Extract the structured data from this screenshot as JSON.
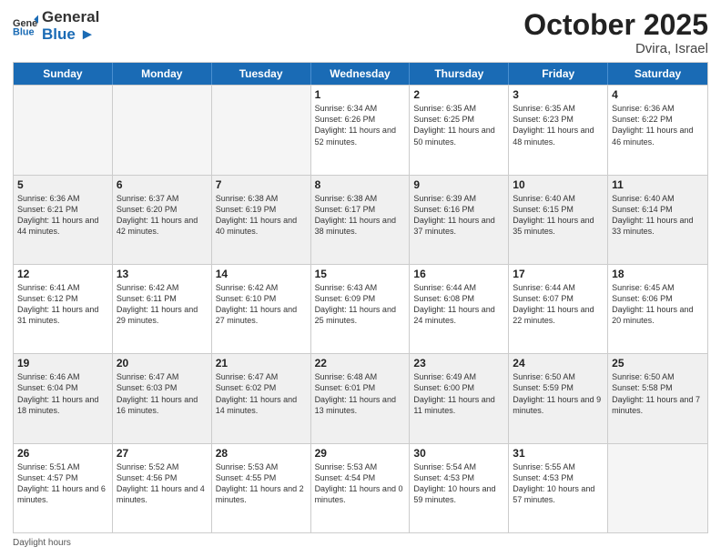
{
  "header": {
    "logo_general": "General",
    "logo_blue": "Blue",
    "month_title": "October 2025",
    "location": "Dvira, Israel"
  },
  "days_of_week": [
    "Sunday",
    "Monday",
    "Tuesday",
    "Wednesday",
    "Thursday",
    "Friday",
    "Saturday"
  ],
  "weeks": [
    [
      {
        "day": "",
        "empty": true
      },
      {
        "day": "",
        "empty": true
      },
      {
        "day": "",
        "empty": true
      },
      {
        "day": "1",
        "sunrise": "Sunrise: 6:34 AM",
        "sunset": "Sunset: 6:26 PM",
        "daylight": "Daylight: 11 hours and 52 minutes."
      },
      {
        "day": "2",
        "sunrise": "Sunrise: 6:35 AM",
        "sunset": "Sunset: 6:25 PM",
        "daylight": "Daylight: 11 hours and 50 minutes."
      },
      {
        "day": "3",
        "sunrise": "Sunrise: 6:35 AM",
        "sunset": "Sunset: 6:23 PM",
        "daylight": "Daylight: 11 hours and 48 minutes."
      },
      {
        "day": "4",
        "sunrise": "Sunrise: 6:36 AM",
        "sunset": "Sunset: 6:22 PM",
        "daylight": "Daylight: 11 hours and 46 minutes."
      }
    ],
    [
      {
        "day": "5",
        "sunrise": "Sunrise: 6:36 AM",
        "sunset": "Sunset: 6:21 PM",
        "daylight": "Daylight: 11 hours and 44 minutes."
      },
      {
        "day": "6",
        "sunrise": "Sunrise: 6:37 AM",
        "sunset": "Sunset: 6:20 PM",
        "daylight": "Daylight: 11 hours and 42 minutes."
      },
      {
        "day": "7",
        "sunrise": "Sunrise: 6:38 AM",
        "sunset": "Sunset: 6:19 PM",
        "daylight": "Daylight: 11 hours and 40 minutes."
      },
      {
        "day": "8",
        "sunrise": "Sunrise: 6:38 AM",
        "sunset": "Sunset: 6:17 PM",
        "daylight": "Daylight: 11 hours and 38 minutes."
      },
      {
        "day": "9",
        "sunrise": "Sunrise: 6:39 AM",
        "sunset": "Sunset: 6:16 PM",
        "daylight": "Daylight: 11 hours and 37 minutes."
      },
      {
        "day": "10",
        "sunrise": "Sunrise: 6:40 AM",
        "sunset": "Sunset: 6:15 PM",
        "daylight": "Daylight: 11 hours and 35 minutes."
      },
      {
        "day": "11",
        "sunrise": "Sunrise: 6:40 AM",
        "sunset": "Sunset: 6:14 PM",
        "daylight": "Daylight: 11 hours and 33 minutes."
      }
    ],
    [
      {
        "day": "12",
        "sunrise": "Sunrise: 6:41 AM",
        "sunset": "Sunset: 6:12 PM",
        "daylight": "Daylight: 11 hours and 31 minutes."
      },
      {
        "day": "13",
        "sunrise": "Sunrise: 6:42 AM",
        "sunset": "Sunset: 6:11 PM",
        "daylight": "Daylight: 11 hours and 29 minutes."
      },
      {
        "day": "14",
        "sunrise": "Sunrise: 6:42 AM",
        "sunset": "Sunset: 6:10 PM",
        "daylight": "Daylight: 11 hours and 27 minutes."
      },
      {
        "day": "15",
        "sunrise": "Sunrise: 6:43 AM",
        "sunset": "Sunset: 6:09 PM",
        "daylight": "Daylight: 11 hours and 25 minutes."
      },
      {
        "day": "16",
        "sunrise": "Sunrise: 6:44 AM",
        "sunset": "Sunset: 6:08 PM",
        "daylight": "Daylight: 11 hours and 24 minutes."
      },
      {
        "day": "17",
        "sunrise": "Sunrise: 6:44 AM",
        "sunset": "Sunset: 6:07 PM",
        "daylight": "Daylight: 11 hours and 22 minutes."
      },
      {
        "day": "18",
        "sunrise": "Sunrise: 6:45 AM",
        "sunset": "Sunset: 6:06 PM",
        "daylight": "Daylight: 11 hours and 20 minutes."
      }
    ],
    [
      {
        "day": "19",
        "sunrise": "Sunrise: 6:46 AM",
        "sunset": "Sunset: 6:04 PM",
        "daylight": "Daylight: 11 hours and 18 minutes."
      },
      {
        "day": "20",
        "sunrise": "Sunrise: 6:47 AM",
        "sunset": "Sunset: 6:03 PM",
        "daylight": "Daylight: 11 hours and 16 minutes."
      },
      {
        "day": "21",
        "sunrise": "Sunrise: 6:47 AM",
        "sunset": "Sunset: 6:02 PM",
        "daylight": "Daylight: 11 hours and 14 minutes."
      },
      {
        "day": "22",
        "sunrise": "Sunrise: 6:48 AM",
        "sunset": "Sunset: 6:01 PM",
        "daylight": "Daylight: 11 hours and 13 minutes."
      },
      {
        "day": "23",
        "sunrise": "Sunrise: 6:49 AM",
        "sunset": "Sunset: 6:00 PM",
        "daylight": "Daylight: 11 hours and 11 minutes."
      },
      {
        "day": "24",
        "sunrise": "Sunrise: 6:50 AM",
        "sunset": "Sunset: 5:59 PM",
        "daylight": "Daylight: 11 hours and 9 minutes."
      },
      {
        "day": "25",
        "sunrise": "Sunrise: 6:50 AM",
        "sunset": "Sunset: 5:58 PM",
        "daylight": "Daylight: 11 hours and 7 minutes."
      }
    ],
    [
      {
        "day": "26",
        "sunrise": "Sunrise: 5:51 AM",
        "sunset": "Sunset: 4:57 PM",
        "daylight": "Daylight: 11 hours and 6 minutes."
      },
      {
        "day": "27",
        "sunrise": "Sunrise: 5:52 AM",
        "sunset": "Sunset: 4:56 PM",
        "daylight": "Daylight: 11 hours and 4 minutes."
      },
      {
        "day": "28",
        "sunrise": "Sunrise: 5:53 AM",
        "sunset": "Sunset: 4:55 PM",
        "daylight": "Daylight: 11 hours and 2 minutes."
      },
      {
        "day": "29",
        "sunrise": "Sunrise: 5:53 AM",
        "sunset": "Sunset: 4:54 PM",
        "daylight": "Daylight: 11 hours and 0 minutes."
      },
      {
        "day": "30",
        "sunrise": "Sunrise: 5:54 AM",
        "sunset": "Sunset: 4:53 PM",
        "daylight": "Daylight: 10 hours and 59 minutes."
      },
      {
        "day": "31",
        "sunrise": "Sunrise: 5:55 AM",
        "sunset": "Sunset: 4:53 PM",
        "daylight": "Daylight: 10 hours and 57 minutes."
      },
      {
        "day": "",
        "empty": true
      }
    ]
  ],
  "footer": {
    "daylight_label": "Daylight hours"
  }
}
